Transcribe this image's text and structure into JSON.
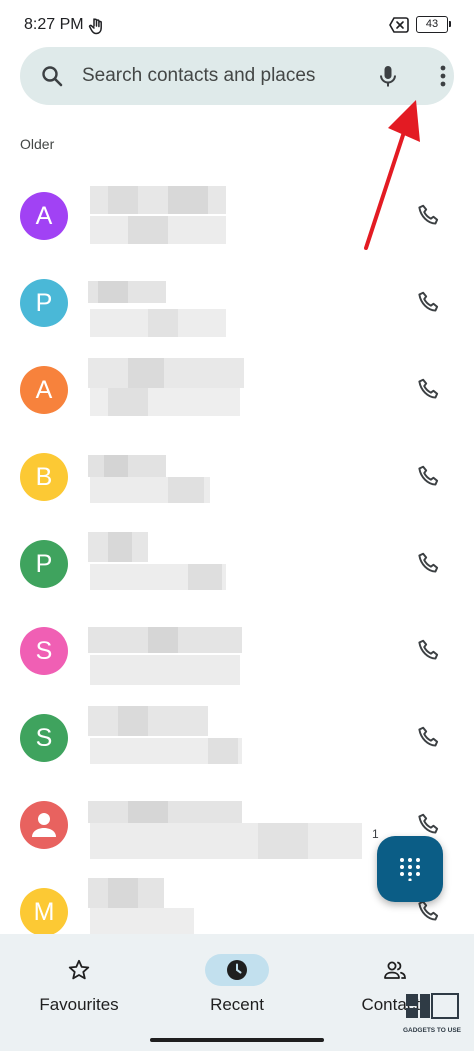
{
  "status_bar": {
    "time": "8:27 PM",
    "battery": "43"
  },
  "search": {
    "placeholder": "Search contacts and places"
  },
  "section_label": "Older",
  "calls": [
    {
      "initial": "A",
      "color": "#a142f4"
    },
    {
      "initial": "P",
      "color": "#4ab8d7"
    },
    {
      "initial": "A",
      "color": "#f7823c"
    },
    {
      "initial": "B",
      "color": "#fcc934"
    },
    {
      "initial": "P",
      "color": "#3fa35e"
    },
    {
      "initial": "S",
      "color": "#f05fb4"
    },
    {
      "initial": "S",
      "color": "#3fa35e"
    },
    {
      "initial": "",
      "color": "#e8625f",
      "icon": "person-icon"
    },
    {
      "initial": "M",
      "color": "#fcc934"
    }
  ],
  "call_meta": "1",
  "nav": {
    "favourites": "Favourites",
    "recent": "Recent",
    "contacts": "Contacts"
  },
  "watermark": "GADGETS TO USE"
}
